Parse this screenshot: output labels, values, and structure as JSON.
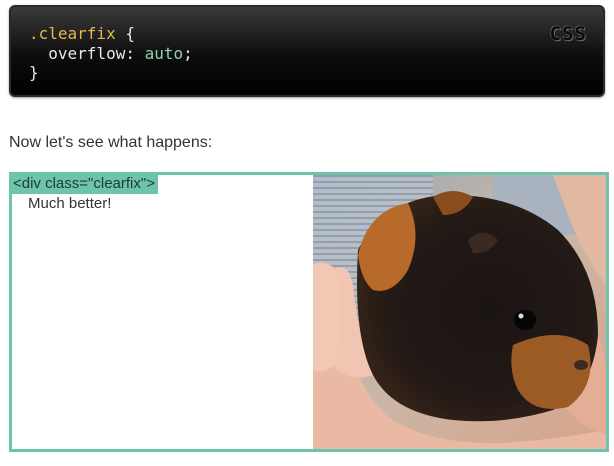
{
  "code": {
    "language": "CSS",
    "line1_selector": ".clearfix",
    "line1_brace": " {",
    "line2_indent": "  ",
    "line2_property": "overflow",
    "line2_colon": ": ",
    "line2_value": "auto",
    "line2_semicolon": ";",
    "line3_brace": "}"
  },
  "text": {
    "paragraph": "Now let's see what happens:"
  },
  "demo": {
    "div_label": "<div class=\"clearfix\">",
    "content": "Much better!",
    "image_subject": "guinea-pig-in-hand",
    "accent_color": "#6cc4aa"
  }
}
